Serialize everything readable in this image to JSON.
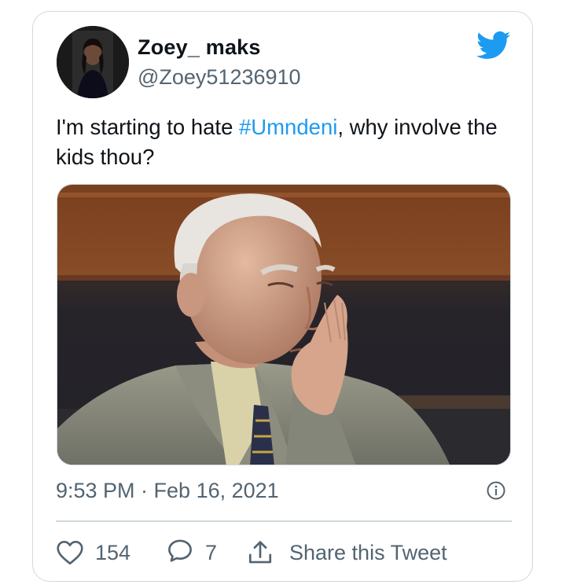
{
  "tweet": {
    "display_name": "Zoey_ maks",
    "handle": "@Zoey51236910",
    "text_before": "I'm starting to hate ",
    "hashtag": "#Umndeni",
    "text_after": ", why involve the kids thou?",
    "timestamp": "9:53 PM · Feb 16, 2021"
  },
  "actions": {
    "likes": "154",
    "replies": "7",
    "share_label": "Share this Tweet"
  },
  "icons": {
    "brand": "twitter-bird-icon",
    "info": "info-icon",
    "like": "heart-icon",
    "reply": "reply-icon",
    "share": "share-icon"
  },
  "colors": {
    "accent": "#1d9bf0",
    "muted_text": "#536471",
    "border": "#cfd9de"
  }
}
